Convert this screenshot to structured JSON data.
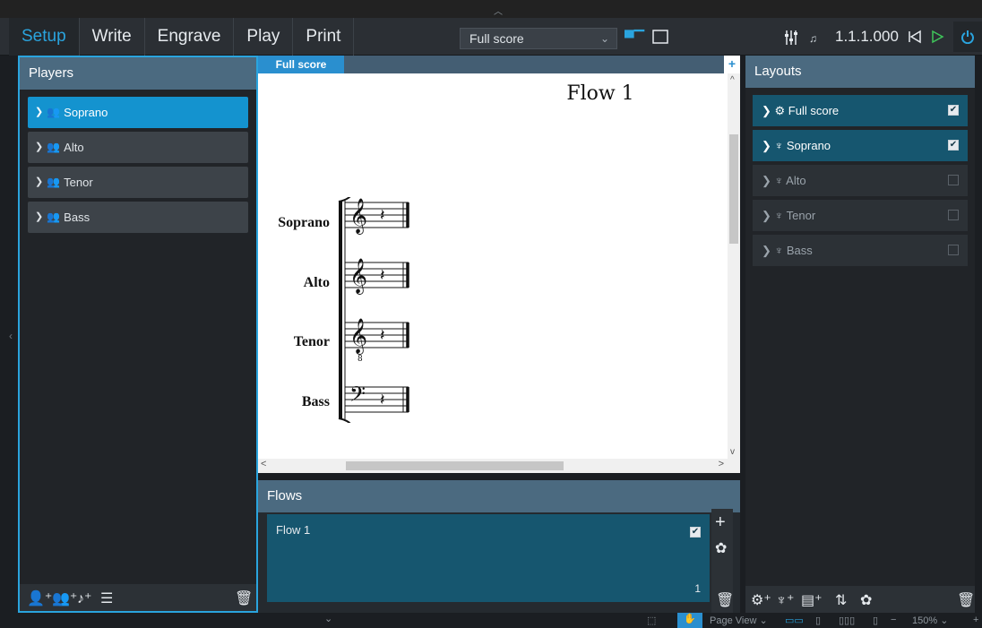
{
  "toolbar": {
    "modes": [
      "Setup",
      "Write",
      "Engrave",
      "Play",
      "Print"
    ],
    "layout_select": "Full score",
    "position": "1.1.1.000",
    "colors": {
      "accent": "#2aa4de",
      "panel_header": "#4b6a80",
      "selected": "#16566f"
    }
  },
  "players": {
    "title": "Players",
    "items": [
      {
        "label": "Soprano"
      },
      {
        "label": "Alto"
      },
      {
        "label": "Tenor"
      },
      {
        "label": "Bass"
      }
    ]
  },
  "score": {
    "tab_label": "Full score",
    "flow_title": "Flow 1",
    "staves": [
      {
        "label": "Soprano",
        "clef": "treble"
      },
      {
        "label": "Alto",
        "clef": "treble"
      },
      {
        "label": "Tenor",
        "clef": "treble-8vb"
      },
      {
        "label": "Bass",
        "clef": "bass"
      }
    ]
  },
  "flows": {
    "title": "Flows",
    "items": [
      {
        "name": "Flow 1",
        "number": "1",
        "checked": true
      }
    ]
  },
  "layouts": {
    "title": "Layouts",
    "items": [
      {
        "label": "Full score",
        "icon": "full-score-icon",
        "checked": true
      },
      {
        "label": "Soprano",
        "icon": "part-layout-icon",
        "checked": true
      },
      {
        "label": "Alto",
        "icon": "part-layout-icon",
        "checked": false
      },
      {
        "label": "Tenor",
        "icon": "part-layout-icon",
        "checked": false
      },
      {
        "label": "Bass",
        "icon": "part-layout-icon",
        "checked": false
      }
    ]
  },
  "statusbar": {
    "view_mode": "Page View",
    "zoom": "150%"
  }
}
